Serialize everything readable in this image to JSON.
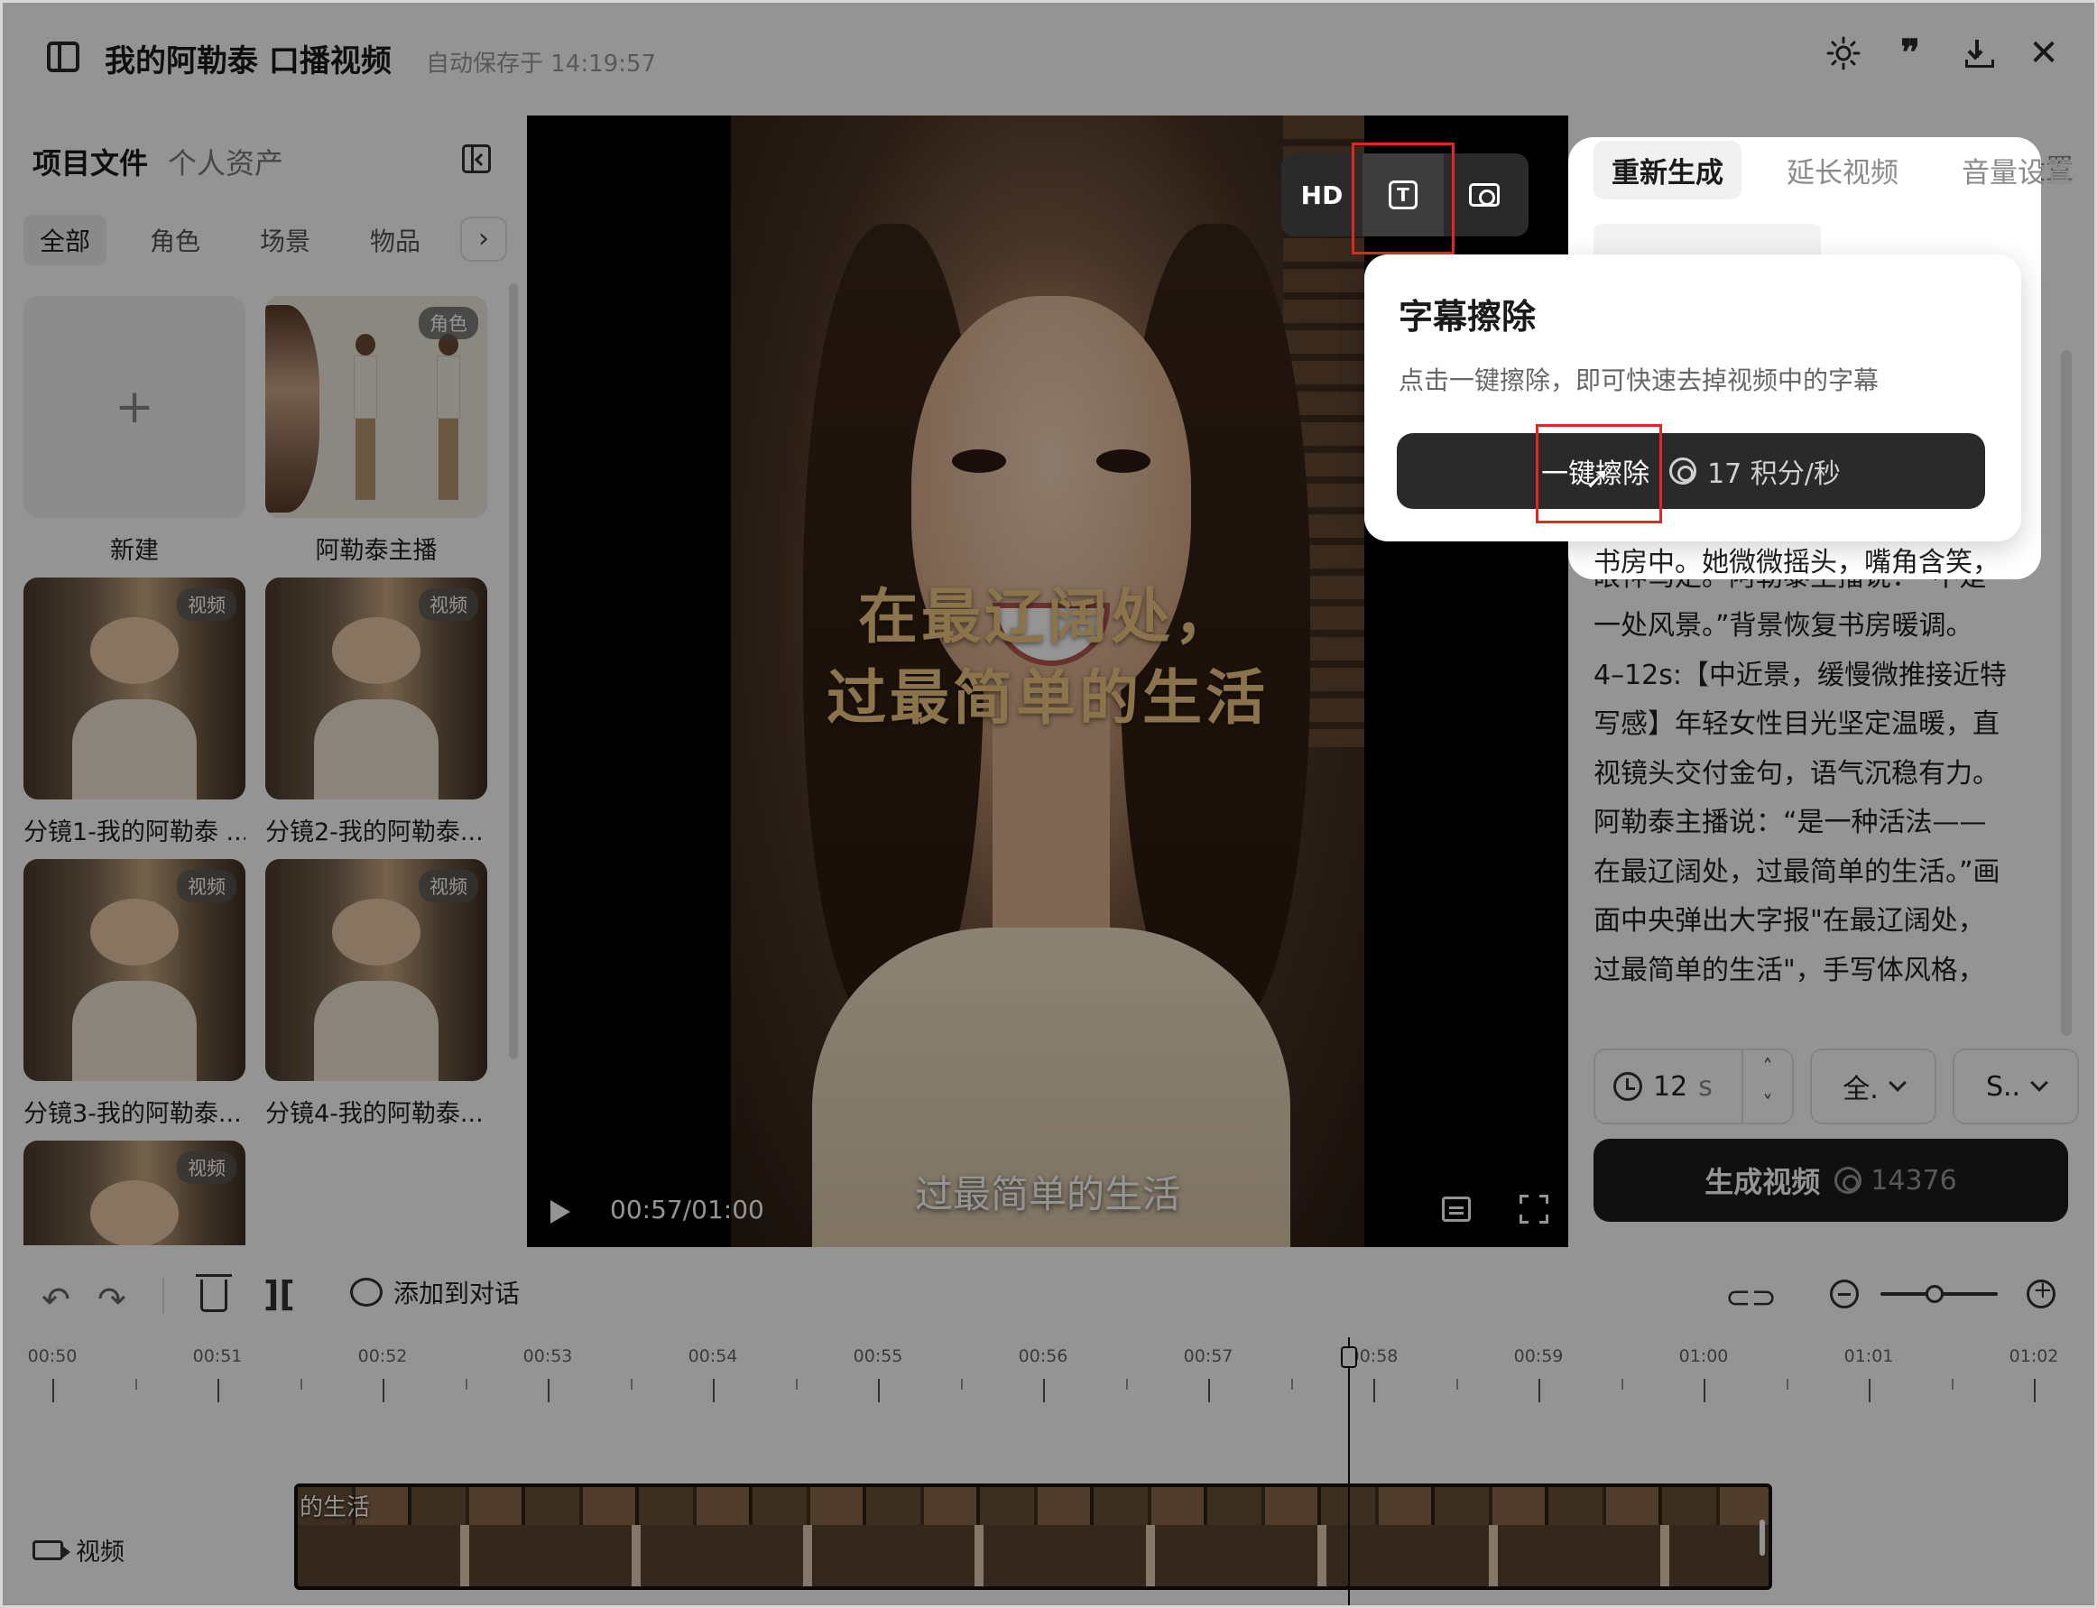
{
  "titlebar": {
    "title": "我的阿勒泰 口播视频",
    "autosave": "自动保存于 14:19:57",
    "icons": [
      "sidebar-toggle-icon",
      "sun-icon",
      "quote-icon",
      "download-icon",
      "close-icon"
    ]
  },
  "left_panel": {
    "tabs": [
      "项目文件",
      "个人资产"
    ],
    "filters": [
      "全部",
      "角色",
      "场景",
      "物品"
    ],
    "active_filter": "全部",
    "assets": [
      {
        "caption": "新建",
        "badge": "",
        "icon": "+"
      },
      {
        "caption": "阿勒泰主播",
        "badge": "角色"
      },
      {
        "caption": "分镜1-我的阿勒泰 ...",
        "badge": "视频"
      },
      {
        "caption": "分镜2-我的阿勒泰...",
        "badge": "视频"
      },
      {
        "caption": "分镜3-我的阿勒泰...",
        "badge": "视频"
      },
      {
        "caption": "分镜4-我的阿勒泰...",
        "badge": "视频"
      },
      {
        "caption": "",
        "badge": "视频"
      }
    ]
  },
  "video": {
    "overlay_buttons": [
      "HD"
    ],
    "big_text_line1": "在最辽阔处，",
    "big_text_line2": "过最简单的生活",
    "subtitle": "过最简单的生活",
    "time": "00:57/01:00"
  },
  "right_panel": {
    "tabs": [
      "重新生成",
      "延长视频",
      "音量设置"
    ],
    "active_tab": "重新生成",
    "prompt_lines": [
      "书房中。她微微摇头，嘴角含笑，",
      "眼神笃定。阿勒泰主播说：“不是",
      "一处风景。”背景恢复书房暖调。",
      "4–12s:【中近景，缓慢微推接近特",
      "写感】年轻女性目光坚定温暖，直",
      "视镜头交付金句，语气沉稳有力。",
      "阿勒泰主播说：“是一种活法——",
      "在最辽阔处，过最简单的生活。”画",
      "面中央弹出大字报\"在最辽阔处，",
      "过最简单的生活\"，手写体风格，"
    ],
    "partial_line_end": ":",
    "duration_value": "12",
    "duration_unit": "s",
    "resolution": "全.",
    "ratio": "S..",
    "generate_label": "生成视频",
    "generate_cost": "14376"
  },
  "popup": {
    "title": "字幕擦除",
    "description": "点击一键擦除，即可快速去掉视频中的字幕",
    "button_label": "一键擦除",
    "cost": "17 积分/秒"
  },
  "timeline": {
    "add_to_chat": "添加到对话",
    "ticks": [
      "00:50",
      "00:51",
      "00:52",
      "00:53",
      "00:54",
      "00:55",
      "00:56",
      "00:57",
      "00:58",
      "00:59",
      "01:00",
      "01:01",
      "01:02"
    ],
    "track_label": "视频",
    "clip_text": "的生活",
    "playhead_time": "00:57.9"
  }
}
